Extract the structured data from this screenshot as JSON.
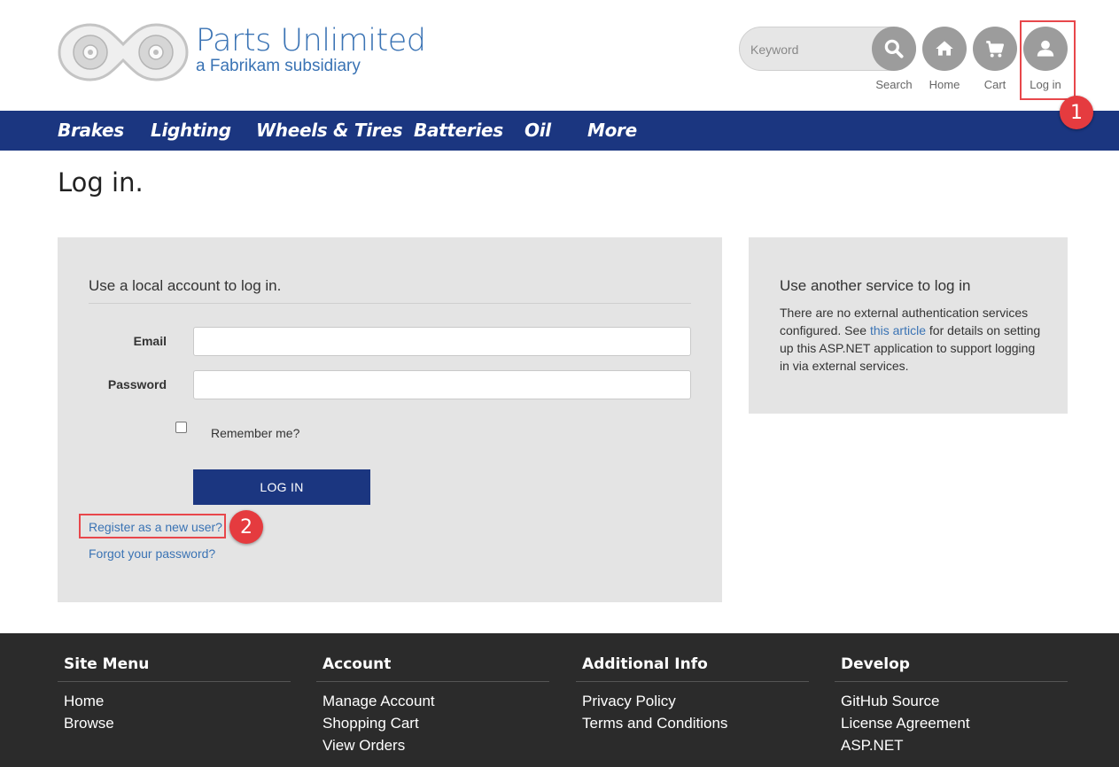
{
  "header": {
    "brand_title": "Parts Unlimited",
    "brand_subtitle": "a Fabrikam subsidiary",
    "search_placeholder": "Keyword",
    "icons": [
      {
        "name": "search-icon",
        "label": "Search"
      },
      {
        "name": "home-icon",
        "label": "Home"
      },
      {
        "name": "cart-icon",
        "label": "Cart"
      },
      {
        "name": "user-icon",
        "label": "Log in"
      }
    ]
  },
  "nav": {
    "items": [
      "Brakes",
      "Lighting",
      "Wheels & Tires",
      "Batteries",
      "Oil",
      "More"
    ]
  },
  "main": {
    "page_title": "Log in.",
    "local": {
      "heading": "Use a local account to log in.",
      "email_label": "Email",
      "password_label": "Password",
      "remember_label": "Remember me?",
      "login_button": "LOG IN",
      "register_link": "Register as a new user?",
      "forgot_link": "Forgot your password?"
    },
    "external": {
      "heading": "Use another service to log in",
      "text_before": "There are no external authentication services configured. See ",
      "link_text": "this article",
      "text_after": " for details on setting up this ASP.NET application to support logging in via external services."
    }
  },
  "callouts": [
    "1",
    "2"
  ],
  "footer": {
    "columns": [
      {
        "heading": "Site Menu",
        "links": [
          "Home",
          "Browse"
        ]
      },
      {
        "heading": "Account",
        "links": [
          "Manage Account",
          "Shopping Cart",
          "View Orders"
        ]
      },
      {
        "heading": "Additional Info",
        "links": [
          "Privacy Policy",
          "Terms and Conditions"
        ]
      },
      {
        "heading": "Develop",
        "links": [
          "GitHub Source",
          "License Agreement",
          "ASP.NET"
        ]
      }
    ]
  },
  "colors": {
    "brand_blue": "#3a73b4",
    "nav_blue": "#1b3680",
    "panel_gray": "#e4e4e4",
    "footer_bg": "#2b2b2b",
    "callout_red": "#e53b3f"
  }
}
